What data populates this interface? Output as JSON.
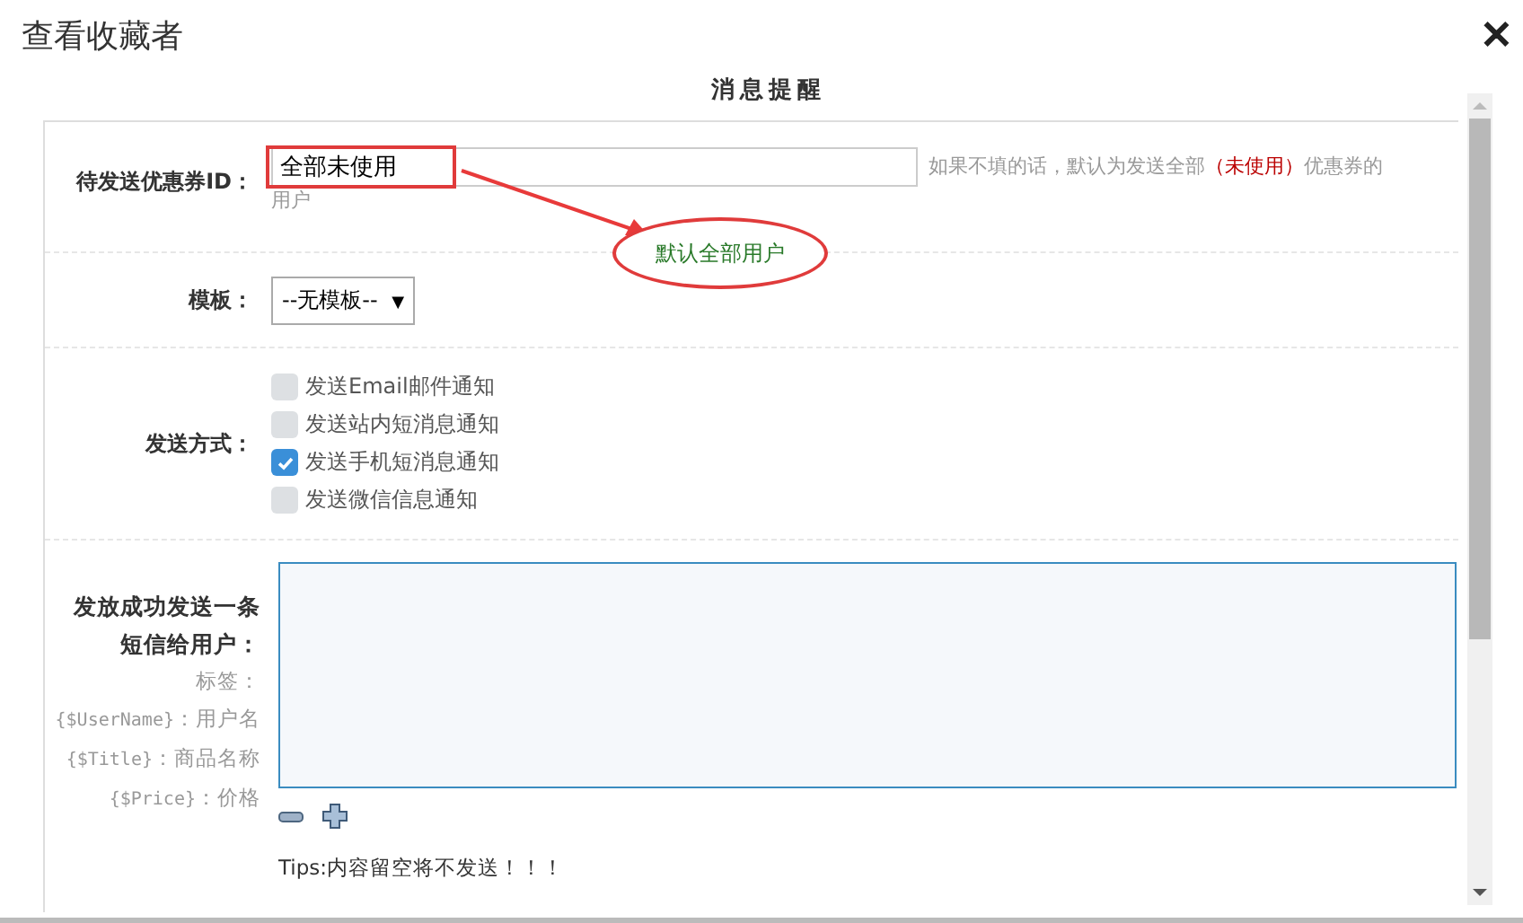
{
  "window": {
    "title": "查看收藏者",
    "close": "✕"
  },
  "section_title": "消息提醒",
  "coupon": {
    "label": "待发送优惠券ID：",
    "value": "全部未使用",
    "hint_before": "如果不填的话，默认为发送全部",
    "hint_emphasis": "（未使用）",
    "hint_after": "优惠券的",
    "hint_wrap": "用户",
    "annotation": "默认全部用户"
  },
  "template": {
    "label": "模板：",
    "value": "--无模板--",
    "caret": "▼"
  },
  "send_method": {
    "label": "发送方式：",
    "options": [
      {
        "label": "发送Email邮件通知",
        "checked": false
      },
      {
        "label": "发送站内短消息通知",
        "checked": false
      },
      {
        "label": "发送手机短消息通知",
        "checked": true
      },
      {
        "label": "发送微信信息通知",
        "checked": false
      }
    ]
  },
  "sms": {
    "label": "发放成功发送一条短信给用户：",
    "tags_title": "标签：",
    "tags": [
      {
        "code": "{$UserName}",
        "desc": "：用户名"
      },
      {
        "code": "{$Title}",
        "desc": "：商品名称"
      },
      {
        "code": "{$Price}",
        "desc": "：价格"
      }
    ],
    "tips": "Tips:内容留空将不发送！！！"
  }
}
